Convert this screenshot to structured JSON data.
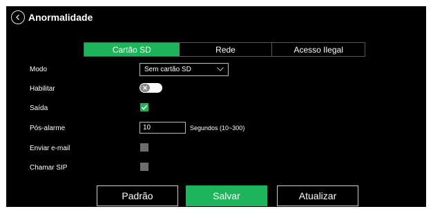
{
  "header": {
    "title": "Anormalidade",
    "back_icon": "chevron-left-icon",
    "close_glyph": "x"
  },
  "tabs": [
    {
      "label": "Cartão SD",
      "active": true
    },
    {
      "label": "Rede",
      "active": false
    },
    {
      "label": "Acesso Ilegal",
      "active": false
    }
  ],
  "form": {
    "mode_label": "Modo",
    "mode_value": "Sem cartão SD",
    "enable_label": "Habilitar",
    "enable_on": false,
    "output_label": "Saída",
    "output_checked": true,
    "post_alarm_label": "Pós-alarme",
    "post_alarm_value": "10",
    "post_alarm_hint": "Segundos (10~300)",
    "email_label": "Enviar e-mail",
    "email_checked": false,
    "sip_label": "Chamar SIP",
    "sip_checked": false
  },
  "buttons": {
    "default_label": "Padrão",
    "save_label": "Salvar",
    "refresh_label": "Atualizar"
  },
  "colors": {
    "accent": "#1db45a",
    "background": "#000000",
    "text": "#ffffff"
  }
}
